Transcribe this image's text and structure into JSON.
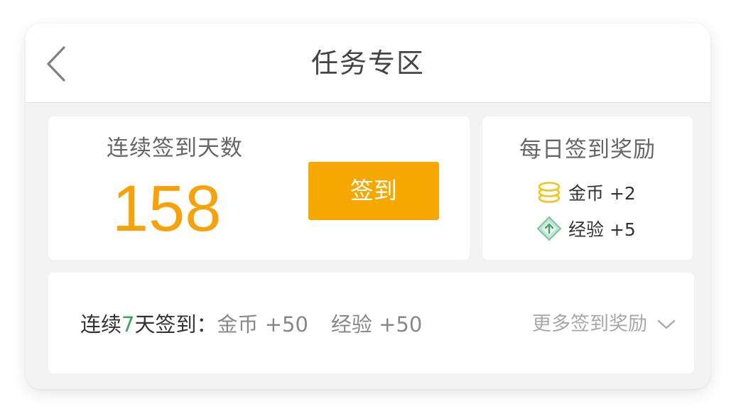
{
  "header": {
    "title": "任务专区",
    "back_icon": "chevron-left-icon"
  },
  "streak": {
    "label": "连续签到天数",
    "count": "158",
    "count_color": "#f7a20a",
    "button_label": "签到",
    "button_color": "#f7a800"
  },
  "daily_reward": {
    "title": "每日签到奖励",
    "items": [
      {
        "icon": "coin-stack-icon",
        "label": "金币 +2"
      },
      {
        "icon": "experience-gem-icon",
        "label": "经验 +5"
      }
    ]
  },
  "bonus": {
    "prefix": "连续",
    "days": "7",
    "days_color": "#3fa35a",
    "suffix": "天签到：",
    "coin_reward": "金币 +50",
    "exp_reward": "经验 +50",
    "more_label": "更多签到奖励",
    "more_icon": "chevron-down-icon"
  }
}
